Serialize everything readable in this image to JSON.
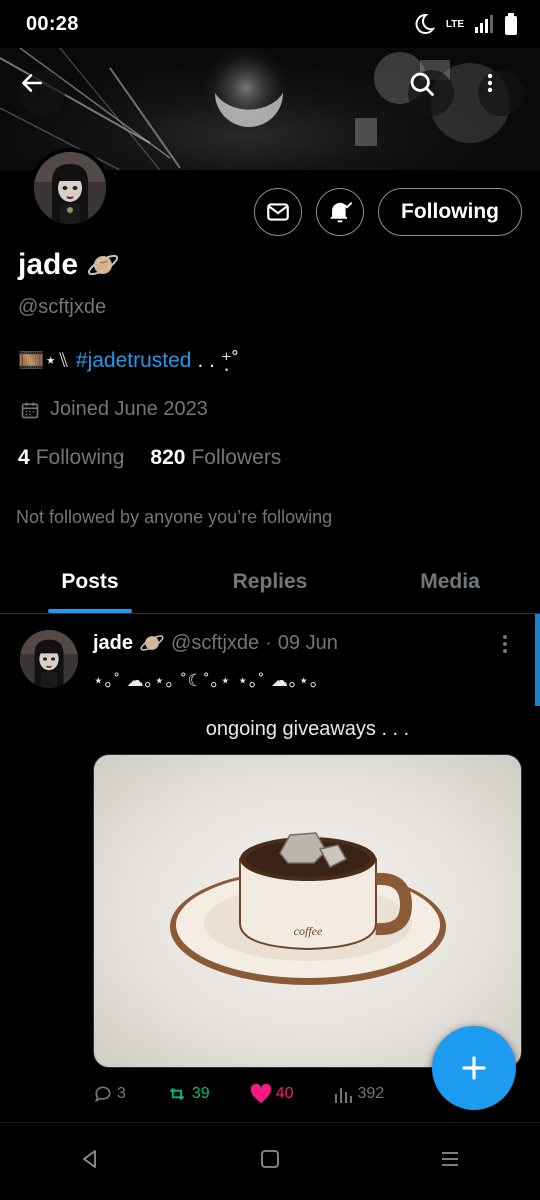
{
  "status_bar": {
    "time": "00:28",
    "network": "LTE"
  },
  "profile": {
    "display_name": "jade",
    "handle": "@scftjxde",
    "bio_prefix": "🎞️⋆⑊",
    "bio_hashtag": "#jadetrusted",
    "bio_suffix": ". . ⁺̣˚",
    "joined": "Joined June 2023",
    "following_count": "4",
    "following_label": "Following",
    "followers_count": "820",
    "followers_label": "Followers",
    "not_followed_text": "Not followed by anyone you’re following",
    "follow_button_label": "Following"
  },
  "tabs": [
    {
      "label": "Posts",
      "active": true
    },
    {
      "label": "Replies",
      "active": false
    },
    {
      "label": "Media",
      "active": false
    }
  ],
  "post": {
    "author_name": "jade",
    "author_handle": "@scftjxde",
    "separator": "·",
    "date": "09 Jun",
    "decor_line": "⋆｡˚ ☁︎｡⋆｡ ˚☾˚｡⋆ ⋆｡˚ ☁︎｡⋆｡",
    "text": "ongoing giveaways . . .",
    "media_cup_label": "coffee",
    "replies": "3",
    "reposts": "39",
    "likes": "40",
    "views": "392"
  },
  "colors": {
    "accent": "#1d9bf0",
    "repost": "#00ba7c",
    "like": "#f91880",
    "muted": "#71767b"
  },
  "icons": [
    "back-arrow-icon",
    "search-icon",
    "more-vertical-icon",
    "mail-icon",
    "bell-check-icon",
    "calendar-icon",
    "reply-icon",
    "repost-icon",
    "heart-icon",
    "views-icon",
    "plus-icon",
    "nav-back-icon",
    "nav-home-icon",
    "nav-recents-icon"
  ]
}
